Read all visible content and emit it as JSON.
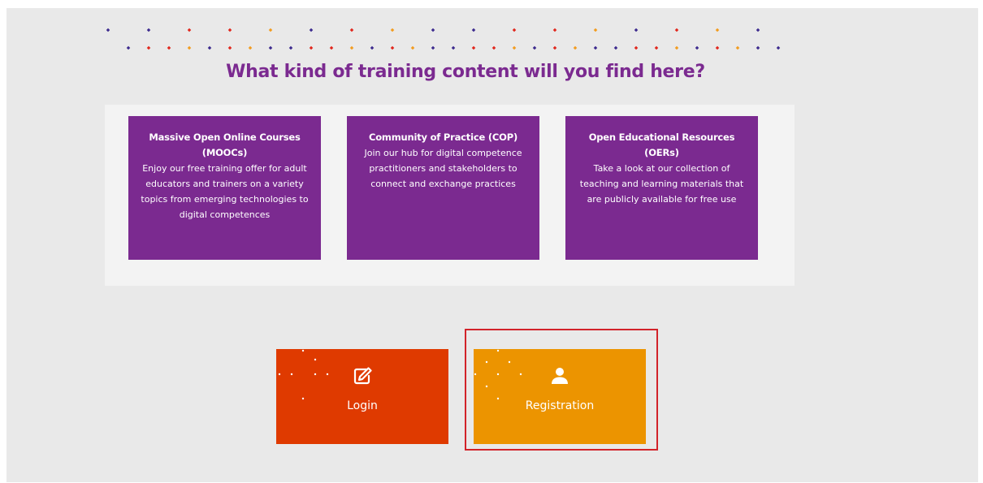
{
  "heading": "What kind of training content will you find here?",
  "colors": {
    "purple": "#7b2a90",
    "heading": "#7b2a90",
    "orange_red": "#df3a00",
    "amber": "#ec9400",
    "highlight_border": "#d2232a",
    "dot_purple": "#3c2a8e",
    "dot_red": "#e1261c",
    "dot_orange": "#f29c1f"
  },
  "cards": [
    {
      "title": "Massive Open Online Courses (MOOCs)",
      "description": "Enjoy our free training offer for adult educators and trainers on a variety topics from emerging technologies to digital competences"
    },
    {
      "title": "Community of Practice (COP)",
      "description": "Join our hub for digital competence practitioners and stakeholders to connect and exchange practices"
    },
    {
      "title": "Open Educational Resources (OERs)",
      "description": "Take a look at our collection of teaching and learning materials that are publicly available for free use"
    }
  ],
  "buttons": {
    "login": {
      "label": "Login",
      "icon": "edit-icon"
    },
    "registration": {
      "label": "Registration",
      "icon": "user-icon"
    }
  }
}
